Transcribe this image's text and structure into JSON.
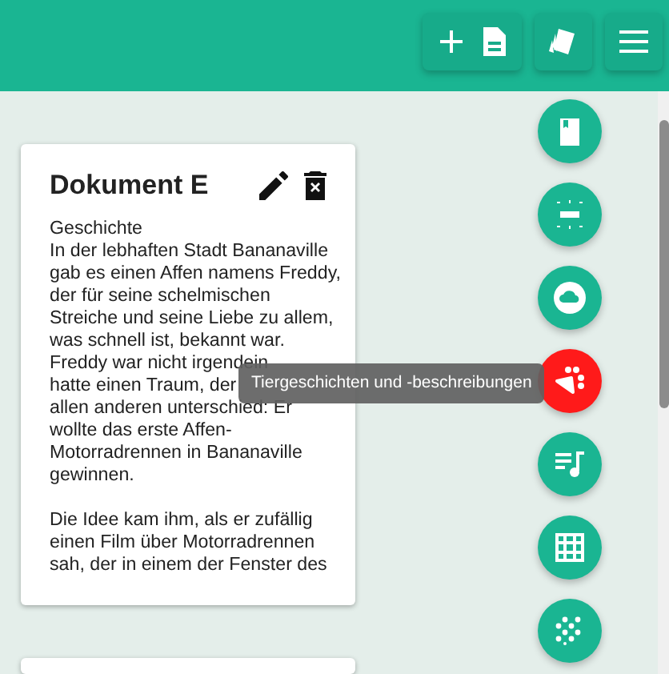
{
  "toolbar": {
    "buttons": [
      {
        "kind": "new-document"
      },
      {
        "kind": "cards"
      },
      {
        "kind": "menu"
      }
    ]
  },
  "document_card": {
    "title": "Dokument E",
    "category": "Geschichte",
    "paragraphs": [
      [
        "In der lebhaften Stadt Bananaville",
        "gab es einen Affen namens Freddy,",
        "der für seine schelmischen",
        "Streiche und seine Liebe zu allem,",
        "was schnell ist, bekannt war.",
        "Freddy war nicht irgendein",
        "hatte einen Traum, der",
        "allen anderen unterschied: Er",
        "wollte das erste Affen-",
        "Motorradrennen in Bananaville",
        "gewinnen."
      ],
      [
        "Die Idee kam ihm, als er zufällig",
        "einen Film über Motorradrennen",
        "sah, der in einem der Fenster des"
      ]
    ]
  },
  "category_buttons": [
    {
      "kind": "book",
      "selected": false
    },
    {
      "kind": "highlight",
      "selected": false
    },
    {
      "kind": "cloud",
      "selected": false
    },
    {
      "kind": "paw",
      "selected": true
    },
    {
      "kind": "playlist",
      "selected": false
    },
    {
      "kind": "grid",
      "selected": false
    },
    {
      "kind": "dots",
      "selected": false
    }
  ],
  "tooltip": "Tiergeschichten und -beschreibungen"
}
